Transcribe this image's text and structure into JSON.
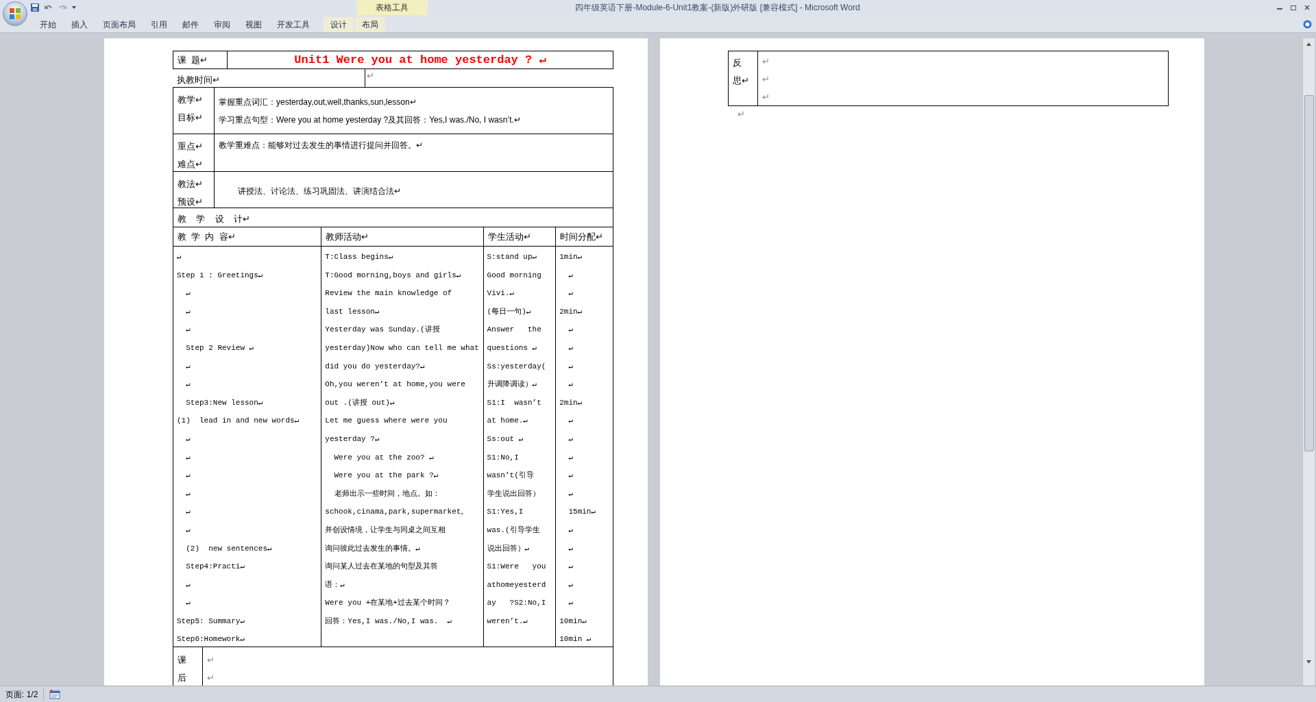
{
  "window": {
    "title": "四年级英语下册-Module-6-Unit1教案-(新版)外研版 [兼容模式] - Microsoft Word"
  },
  "contextual_group": {
    "label": "表格工具"
  },
  "ribbon_tabs": [
    {
      "label": "开始",
      "selected": false,
      "contextual": false
    },
    {
      "label": "插入",
      "selected": false,
      "contextual": false
    },
    {
      "label": "页面布局",
      "selected": false,
      "contextual": false
    },
    {
      "label": "引用",
      "selected": false,
      "contextual": false
    },
    {
      "label": "邮件",
      "selected": false,
      "contextual": false
    },
    {
      "label": "审阅",
      "selected": false,
      "contextual": false
    },
    {
      "label": "视图",
      "selected": false,
      "contextual": false
    },
    {
      "label": "开发工具",
      "selected": false,
      "contextual": false
    },
    {
      "label": "设计",
      "selected": false,
      "contextual": true
    },
    {
      "label": "布局",
      "selected": false,
      "contextual": true
    }
  ],
  "lesson_plan": {
    "topic": {
      "label": "课  题↵",
      "value": "Unit1 Were you at home yesterday ? ↵"
    },
    "time_row": {
      "label": "执教时间↵",
      "value": "↵"
    },
    "info_rows": [
      {
        "label_lines": [
          "教学↵",
          "目标↵"
        ],
        "content_lines": [
          "掌握重点词汇：yesterday,out,well,thanks,sun,lesson↵",
          "学习重点句型：Were you at home yesterday ?及其回答：Yes,I was./No, I wasn’t.↵"
        ]
      },
      {
        "label_lines": [
          "重点↵",
          "难点↵"
        ],
        "content_lines": [
          "教学重难点：能够对过去发生的事情进行提问并回答。↵"
        ]
      },
      {
        "label_lines": [
          "教法↵",
          "预设↵"
        ],
        "content_lines": [
          "讲授法、讨论法、练习巩固法、讲演结合法↵"
        ]
      }
    ],
    "design_heading": "教    学    设    计↵",
    "columns": [
      "教  学  内  容↵",
      "教师活动↵",
      "学生活动↵",
      "时间分配↵"
    ],
    "content_columns": [
      [
        "↵",
        "Step 1 : Greetings↵",
        "  ↵",
        "  ↵",
        "  ↵",
        "  Step 2 Review ↵",
        "  ↵",
        "  ↵",
        "  Step3:New lesson↵",
        "(1)  lead in and new words↵",
        "  ↵",
        "  ↵",
        "  ↵",
        "  ↵",
        "  ↵",
        "  ↵",
        "  (2)  new sentences↵",
        "  Step4:Practi↵",
        "  ↵",
        "  ↵",
        "Step5: Summary↵",
        "Step6:Homework↵"
      ],
      [
        "T:Class begins↵",
        "T:Good morning,boys and girls↵",
        "Review the main knowledge of",
        "last lesson↵",
        "Yesterday was Sunday.(讲授",
        "yesterday)Now who can tell me what",
        "did you do yesterday?↵",
        "Oh,you weren’t at home,you were",
        "out .(讲授 out)↵",
        "Let me guess where were you",
        "yesterday ?↵",
        "  Were you at the zoo? ↵",
        "  Were you at the park ?↵",
        "  老师出示一些时间，地点。如：",
        "schook,cinama,park,supermarket。",
        "并创设情境，让学生与同桌之间互相",
        "询问彼此过去发生的事情。↵",
        "询问某人过去在某地的句型及其答",
        "语：↵",
        "Were you +在某地+过去某个时间？",
        "回答：Yes,I was./No,I was.  ↵"
      ],
      [
        "S:stand up↵",
        "Good morning",
        "Vivi.↵",
        "(每日一句)↵",
        "Answer   the",
        "questions ↵",
        "Ss:yesterday(",
        "升调降调读）↵",
        "S1:I  wasn’t",
        "at home.↵",
        "Ss:out ↵",
        "S1:No,I",
        "wasn’t(引导",
        "学生说出回答）",
        "S1:Yes,I",
        "was.(引导学生",
        "说出回答）↵",
        "S1:Were   you",
        "athomeyesterd",
        "ay   ?S2:No,I",
        "weren’t.↵"
      ],
      [
        "1min↵",
        "  ↵",
        "  ↵",
        "2min↵",
        "  ↵",
        "  ↵",
        "  ↵",
        "  ↵",
        "2min↵",
        "  ↵",
        "  ↵",
        "  ↵",
        "  ↵",
        "  ↵",
        "  15min↵",
        "  ↵",
        "  ↵",
        "  ↵",
        "  ↵",
        "  ↵",
        "10min↵",
        "10min ↵"
      ]
    ],
    "after_class": {
      "label_lines": [
        "课",
        "后"
      ],
      "content_lines": [
        "↵",
        "↵"
      ]
    }
  },
  "page2": {
    "reflection": {
      "label_lines": [
        "反",
        "思↵"
      ],
      "content_lines": [
        "↵",
        "↵",
        "↵"
      ]
    },
    "after_mark": "↵"
  },
  "status_bar": {
    "page": "页面: 1/2"
  }
}
